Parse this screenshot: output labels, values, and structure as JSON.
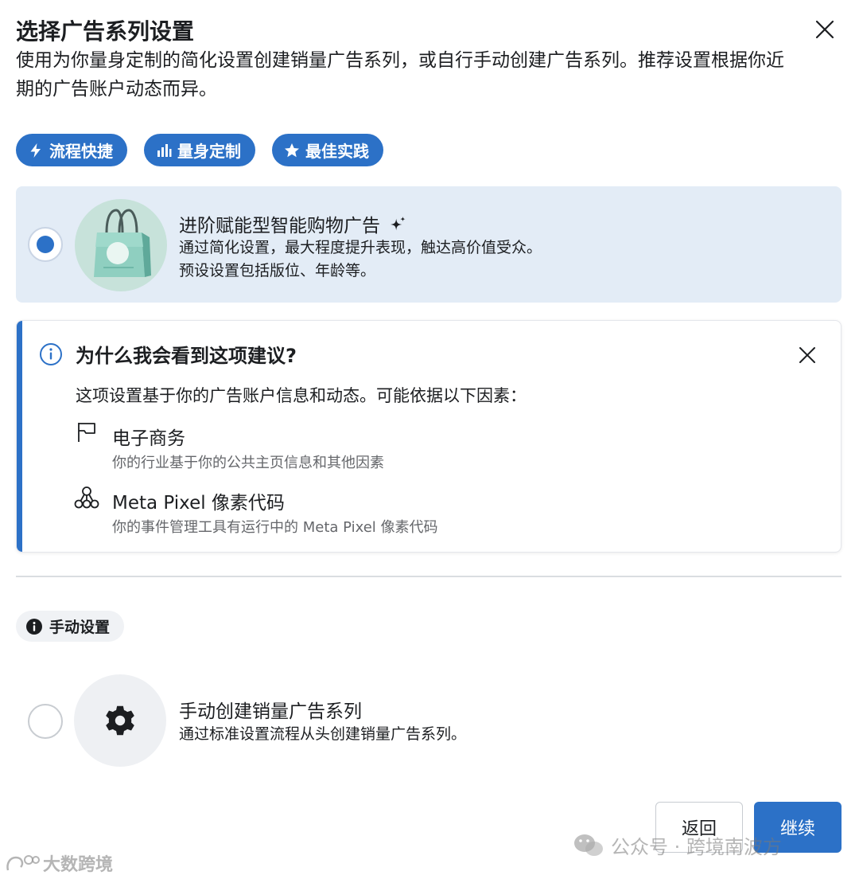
{
  "dialog": {
    "title": "选择广告系列设置",
    "subtitle": "使用为你量身定制的简化设置创建销量广告系列，或自行手动创建广告系列。推荐设置根据你近期的广告账户动态而异。"
  },
  "tags": [
    {
      "label": "流程快捷",
      "icon": "lightning-icon"
    },
    {
      "label": "量身定制",
      "icon": "bar-chart-icon"
    },
    {
      "label": "最佳实践",
      "icon": "star-icon"
    }
  ],
  "advantage_option": {
    "title": "进阶赋能型智能购物广告",
    "description_line1": "通过简化设置，最大程度提升表现，触达高价值受众。",
    "description_line2": "预设设置包括版位、年龄等。",
    "selected": true
  },
  "info_panel": {
    "title": "为什么我会看到这项建议?",
    "body": "这项设置基于你的广告账户信息和动态。可能依据以下因素：",
    "factors": [
      {
        "name": "电子商务",
        "description": "你的行业基于你的公共主页信息和其他因素",
        "icon": "flag-icon"
      },
      {
        "name": "Meta Pixel 像素代码",
        "description": "你的事件管理工具有运行中的 Meta Pixel 像素代码",
        "icon": "pixel-icon"
      }
    ]
  },
  "manual_section": {
    "chip_label": "手动设置",
    "option_title": "手动创建销量广告系列",
    "option_description": "通过标准设置流程从头创建销量广告系列。",
    "selected": false
  },
  "buttons": {
    "back": "返回",
    "continue": "继续"
  },
  "watermarks": {
    "wechat": "公众号 · 跨境南波方",
    "bottom_left": "大数跨境"
  },
  "colors": {
    "accent": "#2c71c7",
    "selected_card_bg": "#e3ecf6",
    "chip_bg": "#f0f2f5"
  }
}
